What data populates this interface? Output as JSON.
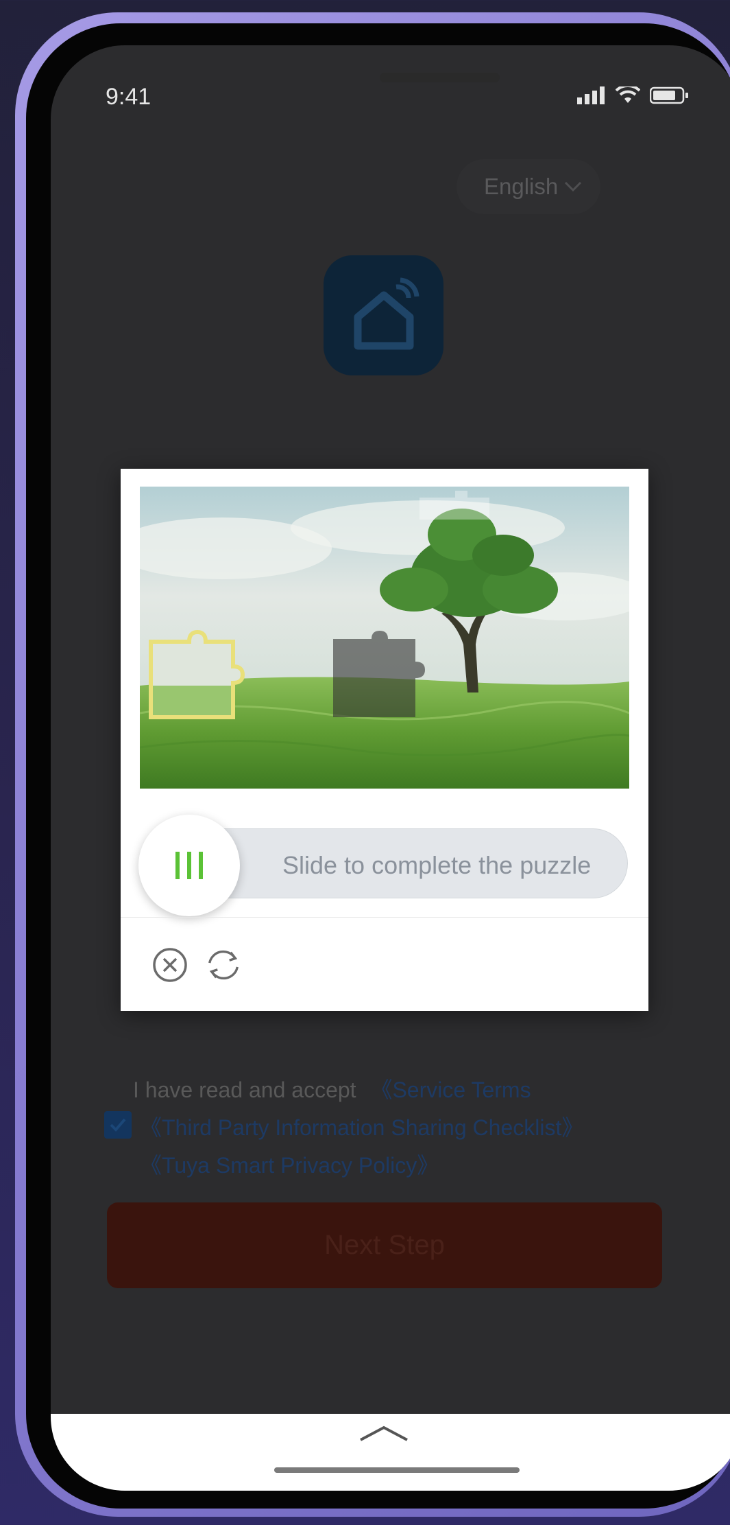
{
  "status_bar": {
    "time": "9:41"
  },
  "language_selector": {
    "value": "English"
  },
  "captcha": {
    "slider_hint": "Slide to complete the puzzle",
    "icons": {
      "close": "close-circle-icon",
      "refresh": "refresh-icon",
      "grip": "grip-lines-icon"
    },
    "accent_color": "#5bc236"
  },
  "agreement": {
    "prefix": "I have read and accept",
    "service_terms": "《Service Terms",
    "third_party": "《Third Party Information Sharing Checklist》",
    "privacy_policy": "《Tuya Smart Privacy Policy》"
  },
  "buttons": {
    "next_step": "Next Step"
  },
  "colors": {
    "link": "#1d3a64",
    "button_bg": "#3a140d",
    "frame": "#a69be6"
  }
}
